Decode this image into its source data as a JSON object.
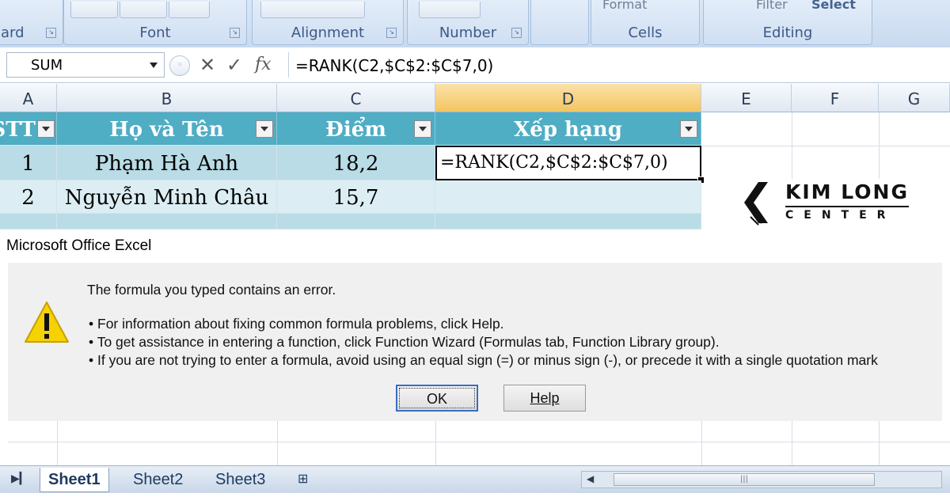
{
  "ribbon": {
    "groups": [
      "ard",
      "Font",
      "Alignment",
      "Number",
      "Cells",
      "Editing"
    ],
    "partial_buttons": [
      "Format",
      "Filter",
      "Select"
    ]
  },
  "formula_bar": {
    "name_box": "SUM",
    "fx_label": "fx",
    "formula": "=RANK(C2,$C$2:$C$7,0)"
  },
  "columns": [
    "A",
    "B",
    "C",
    "D",
    "E",
    "F",
    "G"
  ],
  "table": {
    "headers": [
      "STT",
      "Họ và Tên",
      "Điểm",
      "Xếp hạng"
    ],
    "rows": [
      {
        "stt": "1",
        "name": "Phạm Hà Anh",
        "score": "18,2",
        "rank": "=RANK(C2,$C$2:$C$7,0)"
      },
      {
        "stt": "2",
        "name": "Nguyễn Minh Châu",
        "score": "15,7",
        "rank": ""
      }
    ]
  },
  "logo": {
    "top": "KIM LONG",
    "bottom": "CENTER"
  },
  "dialog": {
    "title": "Microsoft Office Excel",
    "message": "The formula you typed contains an error.",
    "bullets": [
      "For information about fixing common formula problems, click Help.",
      "To get assistance in entering a function, click Function Wizard (Formulas tab, Function Library group).",
      "If you are not trying to enter a formula, avoid using an equal sign (=) or minus sign (-), or precede it with a single quotation mark"
    ],
    "ok_label": "OK",
    "help_label": "Help"
  },
  "sheet_tabs": [
    "Sheet1",
    "Sheet2",
    "Sheet3"
  ],
  "colors": {
    "header_fill": "#4fadc4",
    "row_band": "#b9dce6",
    "ribbon": "#c8daf0"
  }
}
